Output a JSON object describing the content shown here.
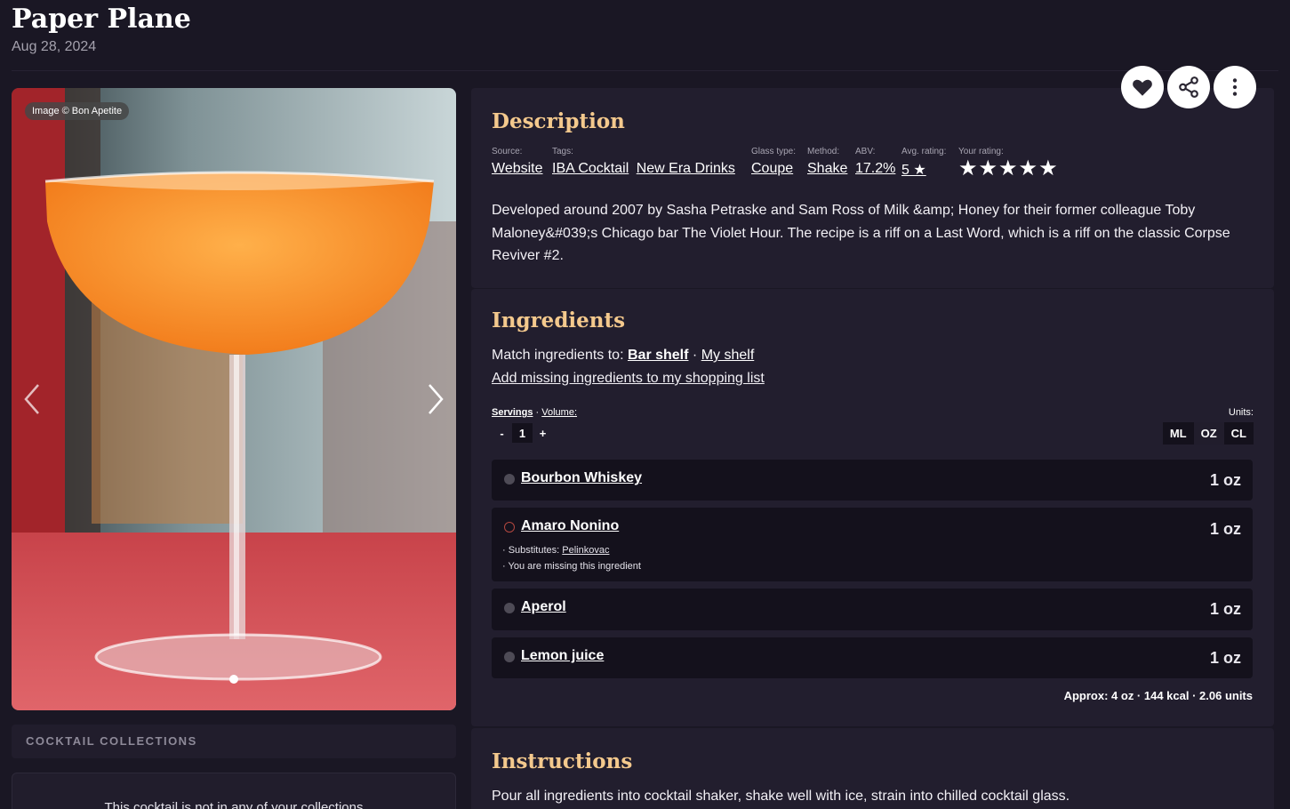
{
  "header": {
    "title": "Paper Plane",
    "date": "Aug 28, 2024"
  },
  "actions": {
    "favorite_icon": "heart-icon",
    "share_icon": "share-icon",
    "more_icon": "more-vertical-icon"
  },
  "image": {
    "credit": "Image © Bon Apetite",
    "prev_icon": "chevron-left-icon",
    "next_icon": "chevron-right-icon",
    "slide_count": 1,
    "active_slide": 1
  },
  "collections": {
    "heading": "COCKTAIL COLLECTIONS",
    "empty_text": "This cocktail is not in any of your collections"
  },
  "description": {
    "heading": "Description",
    "meta": {
      "source_label": "Source:",
      "source_value": "Website",
      "tags_label": "Tags:",
      "tags": [
        "IBA Cocktail",
        "New Era Drinks"
      ],
      "glass_label": "Glass type:",
      "glass_value": "Coupe",
      "method_label": "Method:",
      "method_value": "Shake",
      "abv_label": "ABV:",
      "abv_value": "17.2%",
      "avg_label": "Avg. rating:",
      "avg_value": "5 ★",
      "your_label": "Your rating:",
      "your_stars": "★★★★★"
    },
    "text": "Developed around 2007 by Sasha Petraske and Sam Ross of Milk &amp; Honey for their former colleague Toby Maloney&#039;s Chicago bar The Violet Hour. The recipe is a riff on a Last Word, which is a riff on the classic Corpse Reviver #2."
  },
  "ingredients": {
    "heading": "Ingredients",
    "match_prefix": "Match ingredients to:",
    "match_bar": "Bar shelf",
    "match_sep": "·",
    "match_my": "My shelf",
    "add_missing": "Add missing ingredients to my shopping list",
    "servings_label": "Servings",
    "volume_label": "Volume:",
    "label_sep": "·",
    "minus": "-",
    "servings_value": "1",
    "plus": "+",
    "units_label": "Units:",
    "units": [
      "ML",
      "OZ",
      "CL"
    ],
    "active_unit": "OZ",
    "items": [
      {
        "name": "Bourbon Whiskey",
        "amount": "1 oz",
        "missing": false
      },
      {
        "name": "Amaro Nonino",
        "amount": "1 oz",
        "missing": true,
        "substitutes_label": "· Substitutes:",
        "substitute": "Pelinkovac",
        "missing_note": "· You are missing this ingredient"
      },
      {
        "name": "Aperol",
        "amount": "1 oz",
        "missing": false
      },
      {
        "name": "Lemon juice",
        "amount": "1 oz",
        "missing": false
      }
    ],
    "approx": "Approx: 4 oz · 144 kcal · 2.06 units"
  },
  "instructions": {
    "heading": "Instructions",
    "text": "Pour all ingredients into cocktail shaker, shake well with ice, strain into chilled cocktail glass."
  },
  "colors": {
    "background": "#1a1724",
    "panel": "#221e2e",
    "heading_accent": "#f4c98d",
    "missing": "#b2473f"
  }
}
